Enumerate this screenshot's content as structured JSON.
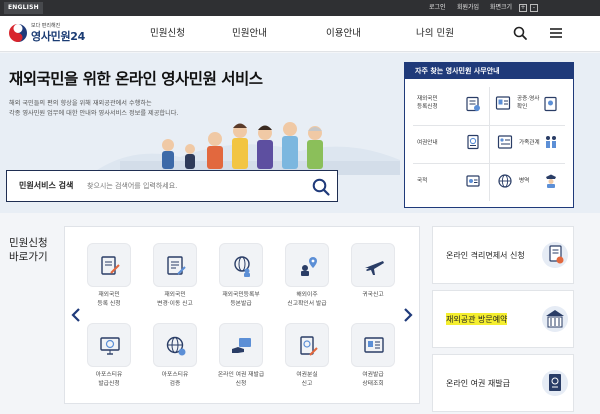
{
  "topbar": {
    "lang": "ENGLISH",
    "login": "로그인",
    "signup": "회원가입",
    "zoom_label": "화면크기",
    "zoom_plus": "+",
    "zoom_minus": "-"
  },
  "header": {
    "logo_sub": "보다 편리해진",
    "logo_main": "영사민원24",
    "nav": [
      "민원신청",
      "민원안내",
      "이용안내",
      "나의 민원"
    ]
  },
  "hero": {
    "title": "재외국민을 위한 온라인 영사민원 서비스",
    "desc_line1": "해외 국민들의 편의 향상을 위해 재외공관에서 수행하는",
    "desc_line2": "각종 영사민원 업무에 대한 안내와 영사서비스 정보를 제공합니다."
  },
  "search": {
    "label": "민원서비스 검색",
    "placeholder": "찾으시는 검색어를 입력하세요."
  },
  "quick": {
    "title": "자주 찾는 영사민원 사무안내",
    "items": [
      {
        "l1": "재외국민",
        "l2": "등록신청",
        "icon": "registration-icon"
      },
      {
        "l1": "공증·영사",
        "l2": "확인",
        "icon": "notary-icon"
      },
      {
        "l1": "여권안내",
        "l2": "",
        "icon": "passport-icon"
      },
      {
        "l1": "가족관계",
        "l2": "",
        "icon": "family-icon"
      },
      {
        "l1": "국적",
        "l2": "",
        "icon": "nationality-icon"
      },
      {
        "l1": "병역",
        "l2": "",
        "icon": "military-icon"
      }
    ]
  },
  "shortcuts": {
    "title_l1": "민원신청",
    "title_l2": "바로가기",
    "items": [
      {
        "l1": "재외국민",
        "l2": "등록 신청",
        "icon": "document-pen-icon"
      },
      {
        "l1": "재외국민",
        "l2": "변경·이동 신고",
        "icon": "document-edit-icon"
      },
      {
        "l1": "재외국민등록부",
        "l2": "등본발급",
        "icon": "globe-person-icon"
      },
      {
        "l1": "해외이주",
        "l2": "신고확인서 발급",
        "icon": "map-pin-person-icon"
      },
      {
        "l1": "귀국신고",
        "l2": "",
        "icon": "airplane-icon"
      },
      {
        "l1": "아포스티유",
        "l2": "발급신청",
        "icon": "monitor-globe-icon"
      },
      {
        "l1": "아포스티유",
        "l2": "검증",
        "icon": "globe-check-icon"
      },
      {
        "l1": "온라인 여권 재발급",
        "l2": "신청",
        "icon": "hand-card-icon"
      },
      {
        "l1": "여권분실",
        "l2": "신고",
        "icon": "passport-lost-icon"
      },
      {
        "l1": "여권발급",
        "l2": "상태조회",
        "icon": "passport-status-icon"
      }
    ]
  },
  "cards": [
    {
      "label": "온라인 격리면제서 신청",
      "icon": "quarantine-doc-icon"
    },
    {
      "label": "재외공관 방문예약",
      "icon": "embassy-icon"
    },
    {
      "label": "온라인 여권 재발급",
      "icon": "passport-reissue-icon"
    }
  ],
  "colors": {
    "navy": "#1f3a7a",
    "highlight": "#f4ee2f",
    "topbar": "#2f3033"
  }
}
